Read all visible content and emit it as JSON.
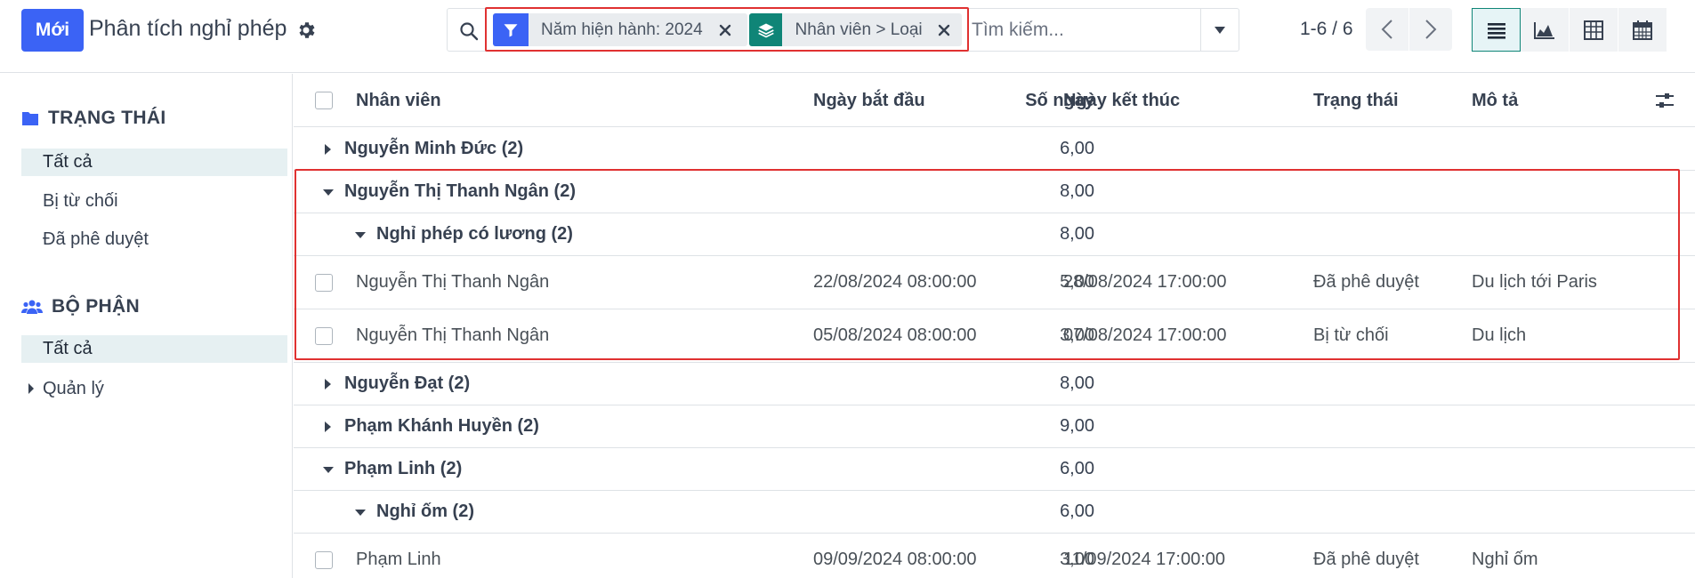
{
  "header": {
    "new_button": "Mới",
    "title": "Phân tích nghỉ phép"
  },
  "search": {
    "facets": [
      {
        "label": "Năm hiện hành: 2024"
      },
      {
        "label": "Nhân viên > Loại"
      }
    ],
    "placeholder": "Tìm kiếm..."
  },
  "pager": {
    "value": "1-6 / 6"
  },
  "colors": {
    "primary": "#3b63f5",
    "groupby_tag": "#0f8577",
    "highlight": "#e03131"
  },
  "sidebar": {
    "sections": [
      {
        "title": "TRẠNG THÁI",
        "icon": "folder-icon",
        "items": [
          "Tất cả",
          "Bị từ chối",
          "Đã phê duyệt"
        ]
      },
      {
        "title": "BỘ PHẬN",
        "icon": "users-icon",
        "items": [
          "Tất cả",
          "Quản lý"
        ]
      }
    ]
  },
  "table": {
    "columns": {
      "employee": "Nhân viên",
      "days": "Số ngày",
      "start": "Ngày bắt đầu",
      "end": "Ngày kết thúc",
      "state": "Trạng thái",
      "desc": "Mô tả"
    },
    "rows": [
      {
        "type": "group",
        "label": "Nguyễn Minh Đức (2)",
        "days": "6,00",
        "expanded": false
      },
      {
        "type": "group",
        "label": "Nguyễn Thị Thanh Ngân (2)",
        "days": "8,00",
        "expanded": true
      },
      {
        "type": "subgroup",
        "label": "Nghỉ phép có lương (2)",
        "days": "8,00",
        "expanded": true
      },
      {
        "type": "record",
        "employee": "Nguyễn Thị Thanh Ngân",
        "days": "5,00",
        "start": "22/08/2024 08:00:00",
        "end": "28/08/2024 17:00:00",
        "state": "Đã phê duyệt",
        "desc": "Du lịch tới Paris"
      },
      {
        "type": "record",
        "employee": "Nguyễn Thị Thanh Ngân",
        "days": "3,00",
        "start": "05/08/2024 08:00:00",
        "end": "07/08/2024 17:00:00",
        "state": "Bị từ chối",
        "desc": "Du lịch"
      },
      {
        "type": "group",
        "label": "Nguyễn Đạt (2)",
        "days": "8,00",
        "expanded": false
      },
      {
        "type": "group",
        "label": "Phạm Khánh Huyền (2)",
        "days": "9,00",
        "expanded": false
      },
      {
        "type": "group",
        "label": "Phạm Linh (2)",
        "days": "6,00",
        "expanded": true
      },
      {
        "type": "subgroup",
        "label": "Nghỉ ốm (2)",
        "days": "6,00",
        "expanded": true
      },
      {
        "type": "record",
        "employee": "Phạm Linh",
        "days": "3,00",
        "start": "09/09/2024 08:00:00",
        "end": "11/09/2024 17:00:00",
        "state": "Đã phê duyệt",
        "desc": "Nghỉ ốm"
      }
    ]
  }
}
